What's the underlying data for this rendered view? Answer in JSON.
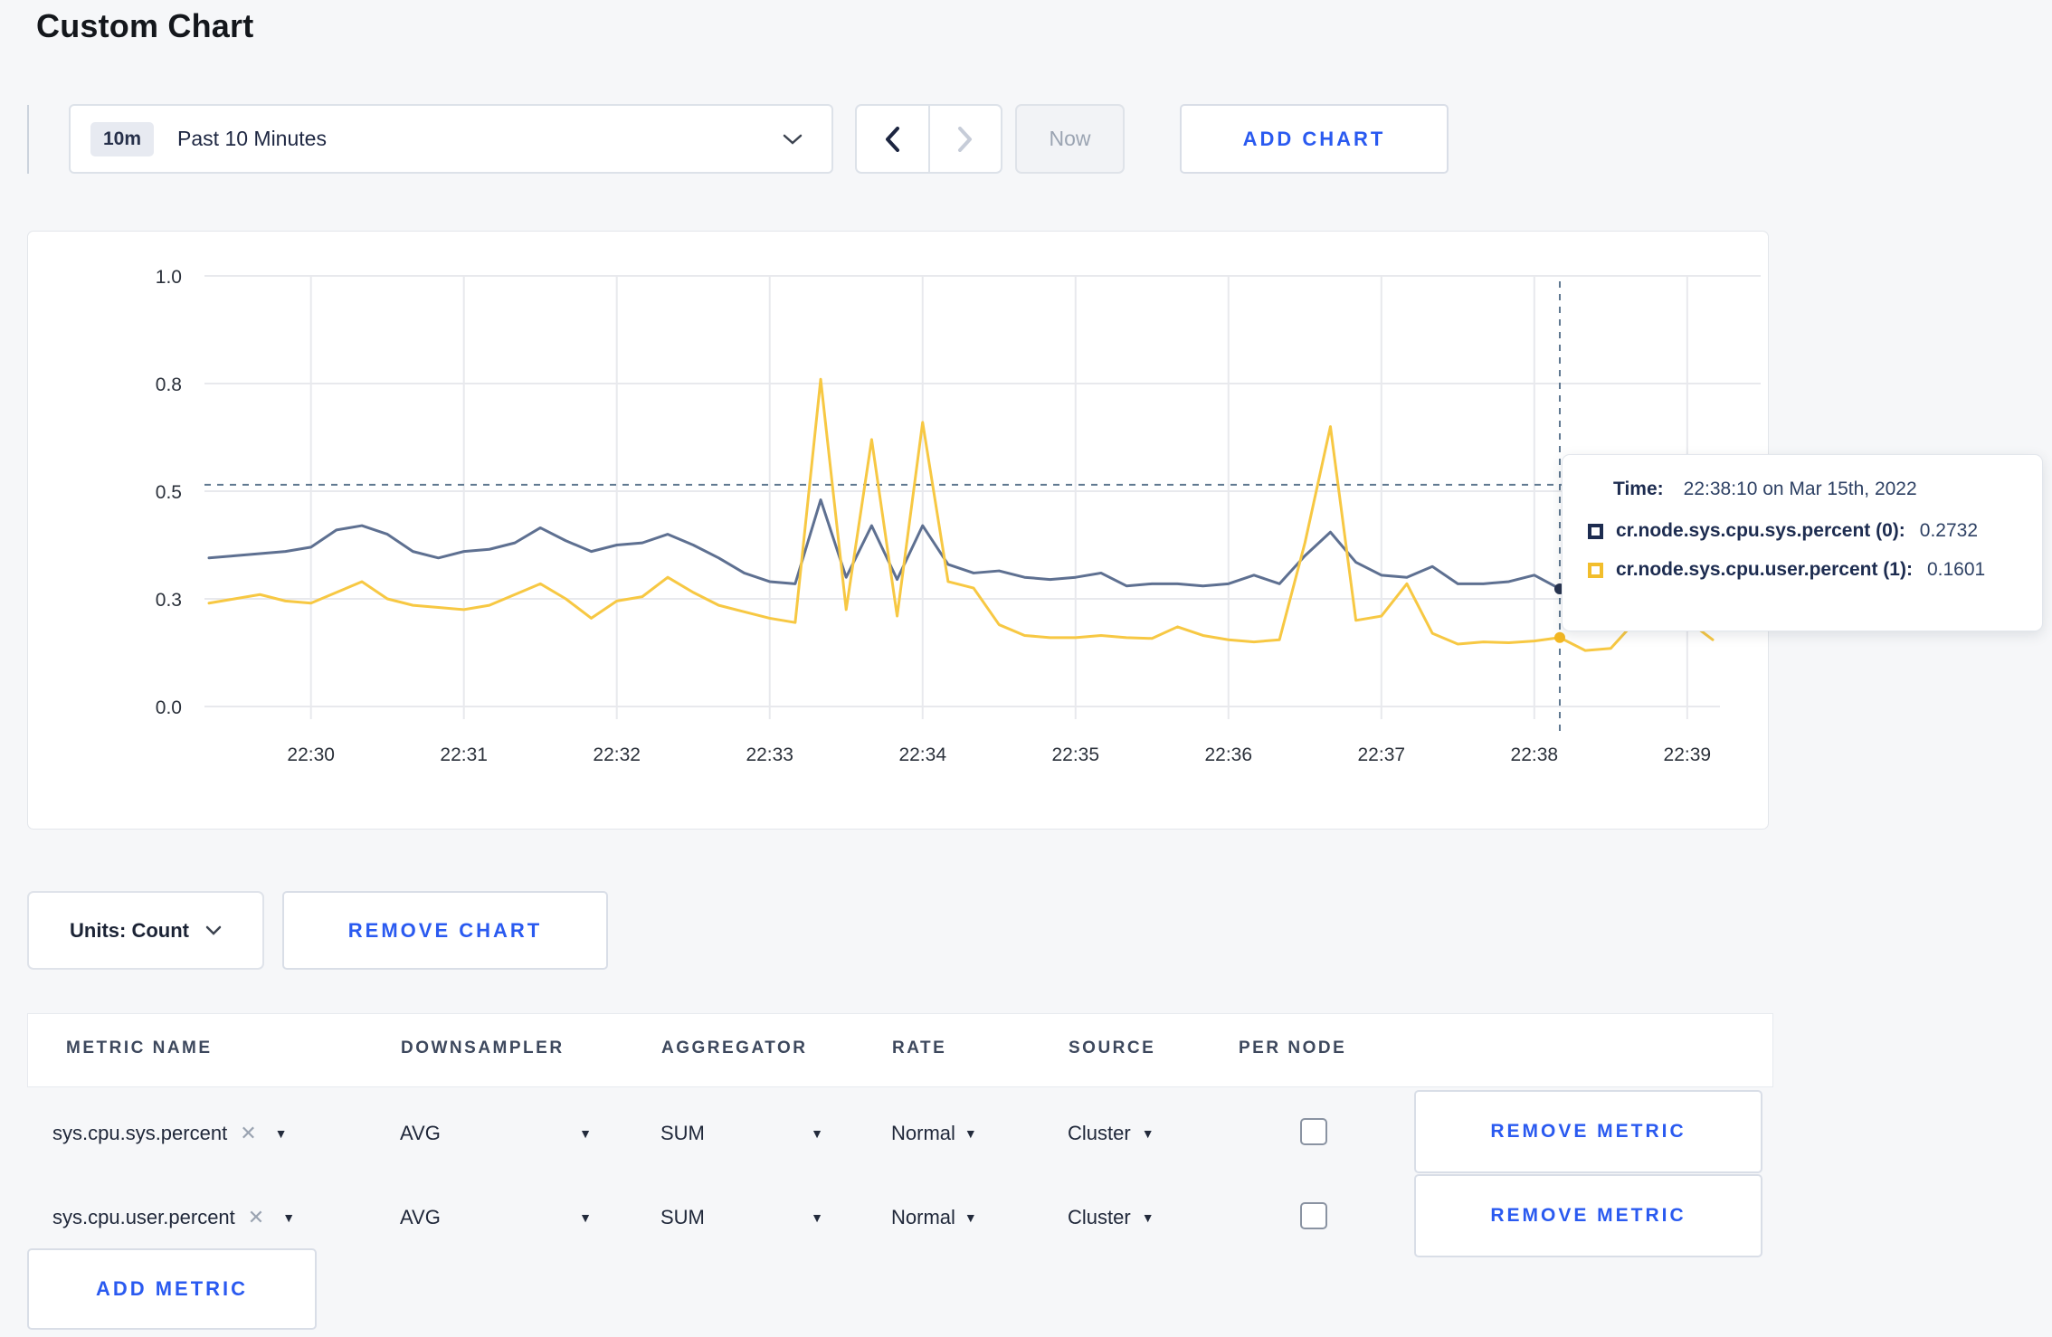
{
  "page": {
    "title": "Custom Chart",
    "background": "#f6f7f9",
    "accent_blue": "#2a5af0"
  },
  "toolbar": {
    "time_window": {
      "badge": "10m",
      "label": "Past 10 Minutes"
    },
    "prev_icon": "chevron-left",
    "next_icon": "chevron-right",
    "now_label": "Now",
    "add_chart_label": "ADD CHART"
  },
  "icons": {
    "close": "✕",
    "caret_down": "▼"
  },
  "chart_data": {
    "type": "line",
    "title": "",
    "x_start_label": "22:29:20",
    "interval_seconds": 10,
    "first_tick_offset_s": 40,
    "tick_interval_s": 60,
    "x_ticks": [
      "22:30",
      "22:31",
      "22:32",
      "22:33",
      "22:34",
      "22:35",
      "22:36",
      "22:37",
      "22:38",
      "22:39"
    ],
    "y_ticks": [
      {
        "value": 0,
        "label": "0.0"
      },
      {
        "value": 0.25,
        "label": "0.3"
      },
      {
        "value": 0.5,
        "label": "0.5"
      },
      {
        "value": 0.75,
        "label": "0.8"
      },
      {
        "value": 1,
        "label": "1.0"
      }
    ],
    "ylim": [
      0,
      1
    ],
    "grid": true,
    "crosshair": {
      "index": 53,
      "time_label": "22:38:10",
      "hline_value": 0.515
    },
    "series": [
      {
        "name": "cr.node.sys.cpu.sys.percent",
        "color": "#5e7091",
        "values": [
          0.345,
          0.35,
          0.355,
          0.36,
          0.37,
          0.41,
          0.42,
          0.4,
          0.36,
          0.345,
          0.36,
          0.365,
          0.38,
          0.415,
          0.385,
          0.36,
          0.375,
          0.38,
          0.4,
          0.375,
          0.345,
          0.31,
          0.29,
          0.285,
          0.48,
          0.3,
          0.42,
          0.295,
          0.42,
          0.33,
          0.31,
          0.315,
          0.3,
          0.295,
          0.3,
          0.31,
          0.28,
          0.285,
          0.285,
          0.28,
          0.285,
          0.305,
          0.285,
          0.35,
          0.405,
          0.335,
          0.305,
          0.3,
          0.325,
          0.285,
          0.285,
          0.29,
          0.305,
          0.2732,
          0.27,
          0.28,
          0.29,
          0.3,
          0.3,
          0.305
        ]
      },
      {
        "name": "cr.node.sys.cpu.user.percent",
        "color": "#f7c843",
        "values": [
          0.24,
          0.25,
          0.26,
          0.245,
          0.24,
          0.265,
          0.29,
          0.25,
          0.235,
          0.23,
          0.225,
          0.235,
          0.26,
          0.285,
          0.25,
          0.205,
          0.245,
          0.255,
          0.3,
          0.265,
          0.235,
          0.22,
          0.205,
          0.195,
          0.76,
          0.225,
          0.62,
          0.21,
          0.66,
          0.29,
          0.275,
          0.19,
          0.165,
          0.16,
          0.16,
          0.165,
          0.16,
          0.158,
          0.185,
          0.165,
          0.155,
          0.15,
          0.155,
          0.38,
          0.65,
          0.2,
          0.21,
          0.285,
          0.17,
          0.145,
          0.15,
          0.148,
          0.152,
          0.1601,
          0.13,
          0.135,
          0.2,
          0.21,
          0.2,
          0.155
        ]
      }
    ]
  },
  "tooltip": {
    "time_label": "Time:",
    "time_value": "22:38:10 on Mar 15th, 2022",
    "series": [
      {
        "name": "cr.node.sys.cpu.sys.percent (0):",
        "value": "0.2732",
        "color": "#1d2c50"
      },
      {
        "name": "cr.node.sys.cpu.user.percent (1):",
        "value": "0.1601",
        "color": "#f2be2c"
      }
    ]
  },
  "chart_actions": {
    "units_label": "Units: Count",
    "remove_chart_label": "REMOVE CHART"
  },
  "metrics_table": {
    "columns": [
      "METRIC NAME",
      "DOWNSAMPLER",
      "AGGREGATOR",
      "RATE",
      "SOURCE",
      "PER NODE"
    ],
    "rows": [
      {
        "name": "sys.cpu.sys.percent",
        "downsampler": "AVG",
        "aggregator": "SUM",
        "rate": "Normal",
        "source": "Cluster",
        "per_node": false,
        "remove_label": "REMOVE METRIC"
      },
      {
        "name": "sys.cpu.user.percent",
        "downsampler": "AVG",
        "aggregator": "SUM",
        "rate": "Normal",
        "source": "Cluster",
        "per_node": false,
        "remove_label": "REMOVE METRIC"
      }
    ],
    "add_metric_label": "ADD METRIC"
  }
}
